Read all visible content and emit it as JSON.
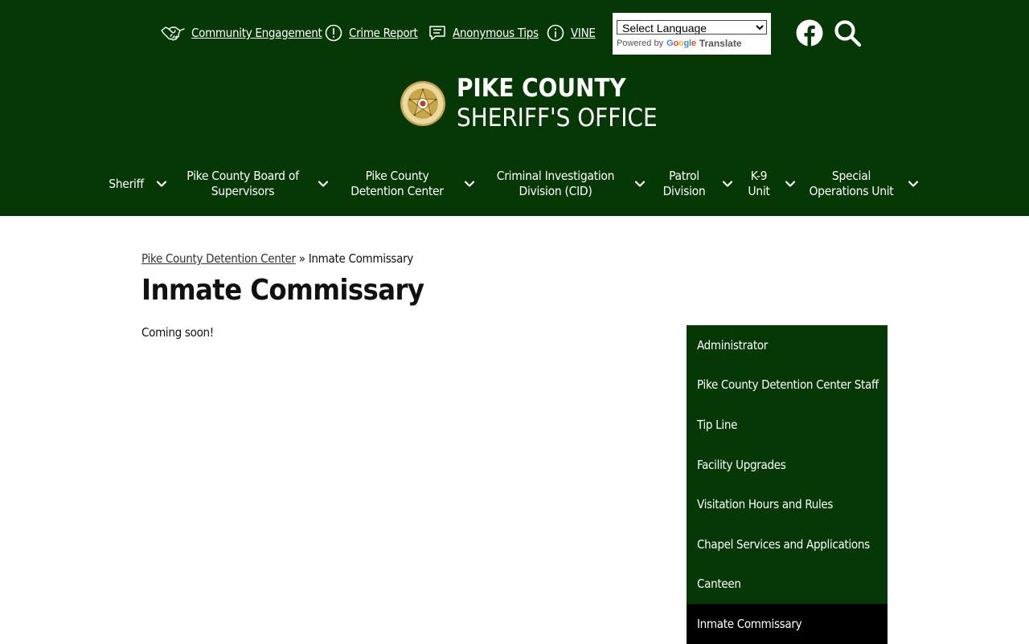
{
  "topbar": {
    "links": [
      {
        "label": "Community Engagement",
        "icon": "handshake-icon"
      },
      {
        "label": "Crime Report",
        "icon": "alert-circle-icon"
      },
      {
        "label": "Anonymous Tips",
        "icon": "chat-icon"
      },
      {
        "label": "VINE",
        "icon": "info-icon"
      }
    ],
    "translate": {
      "selected": "Select Language",
      "powered_by": "Powered by",
      "google": "Google",
      "translate": "Translate"
    },
    "icons": [
      "facebook-icon",
      "search-icon"
    ]
  },
  "brand": {
    "line1": "PIKE COUNTY",
    "line2": "SHERIFF'S OFFICE"
  },
  "nav": [
    {
      "label": "Sheriff"
    },
    {
      "label": "Pike County Board of Supervisors"
    },
    {
      "label": "Pike County Detention Center"
    },
    {
      "label": "Criminal Investigation Division (CID)"
    },
    {
      "label": "Patrol Division"
    },
    {
      "label": "K-9 Unit"
    },
    {
      "label": "Special Operations Unit"
    }
  ],
  "breadcrumb": {
    "parent": "Pike County Detention Center",
    "separator": "»",
    "current": "Inmate Commissary"
  },
  "page": {
    "title": "Inmate Commissary",
    "body": "Coming soon!"
  },
  "sidebar": {
    "items": [
      {
        "label": "Administrator"
      },
      {
        "label": "Pike County Detention Center Staff"
      },
      {
        "label": "Tip Line"
      },
      {
        "label": "Facility Upgrades"
      },
      {
        "label": "Visitation Hours and Rules"
      },
      {
        "label": "Chapel Services and Applications"
      },
      {
        "label": "Canteen"
      },
      {
        "label": "Inmate Commissary"
      }
    ],
    "active_label": "Inmate Commissary"
  },
  "colors": {
    "header_bg": "#063805",
    "sidebar_bg": "#063805",
    "sidebar_active_bg": "#000000",
    "text": "#111111"
  }
}
